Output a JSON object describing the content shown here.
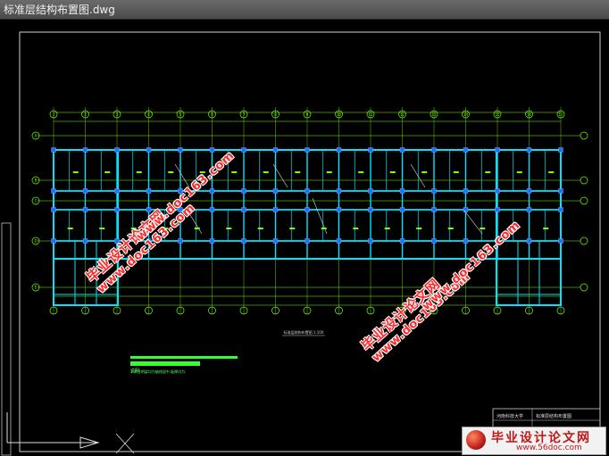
{
  "window": {
    "title": "标准层结构布置图.dwg"
  },
  "drawing": {
    "caption": "标准层结构布置图  1:100",
    "axis_top": [
      "1",
      "2",
      "3",
      "4",
      "5",
      "6",
      "7",
      "8",
      "9",
      "10",
      "11",
      "12",
      "13",
      "14",
      "15",
      "16",
      "17"
    ],
    "axis_side": [
      "A",
      "B",
      "C",
      "D",
      "E"
    ],
    "notes_title": "说明:",
    "note_line": "1.未注明梁均为轴线居中,板厚均为."
  },
  "title_block": {
    "school": "河南科技大学",
    "drawing_name": "标准层结构布置图"
  },
  "watermarks": {
    "cn": "毕业设计论文网",
    "url": "www.doc163.com"
  },
  "logo": {
    "text": "毕业设计论文网",
    "url": "www.56doc.com"
  },
  "colors": {
    "background": "#000000",
    "structure": "#00e5ff",
    "grid": "#7cff00",
    "watermark": "#ff2a2a"
  }
}
